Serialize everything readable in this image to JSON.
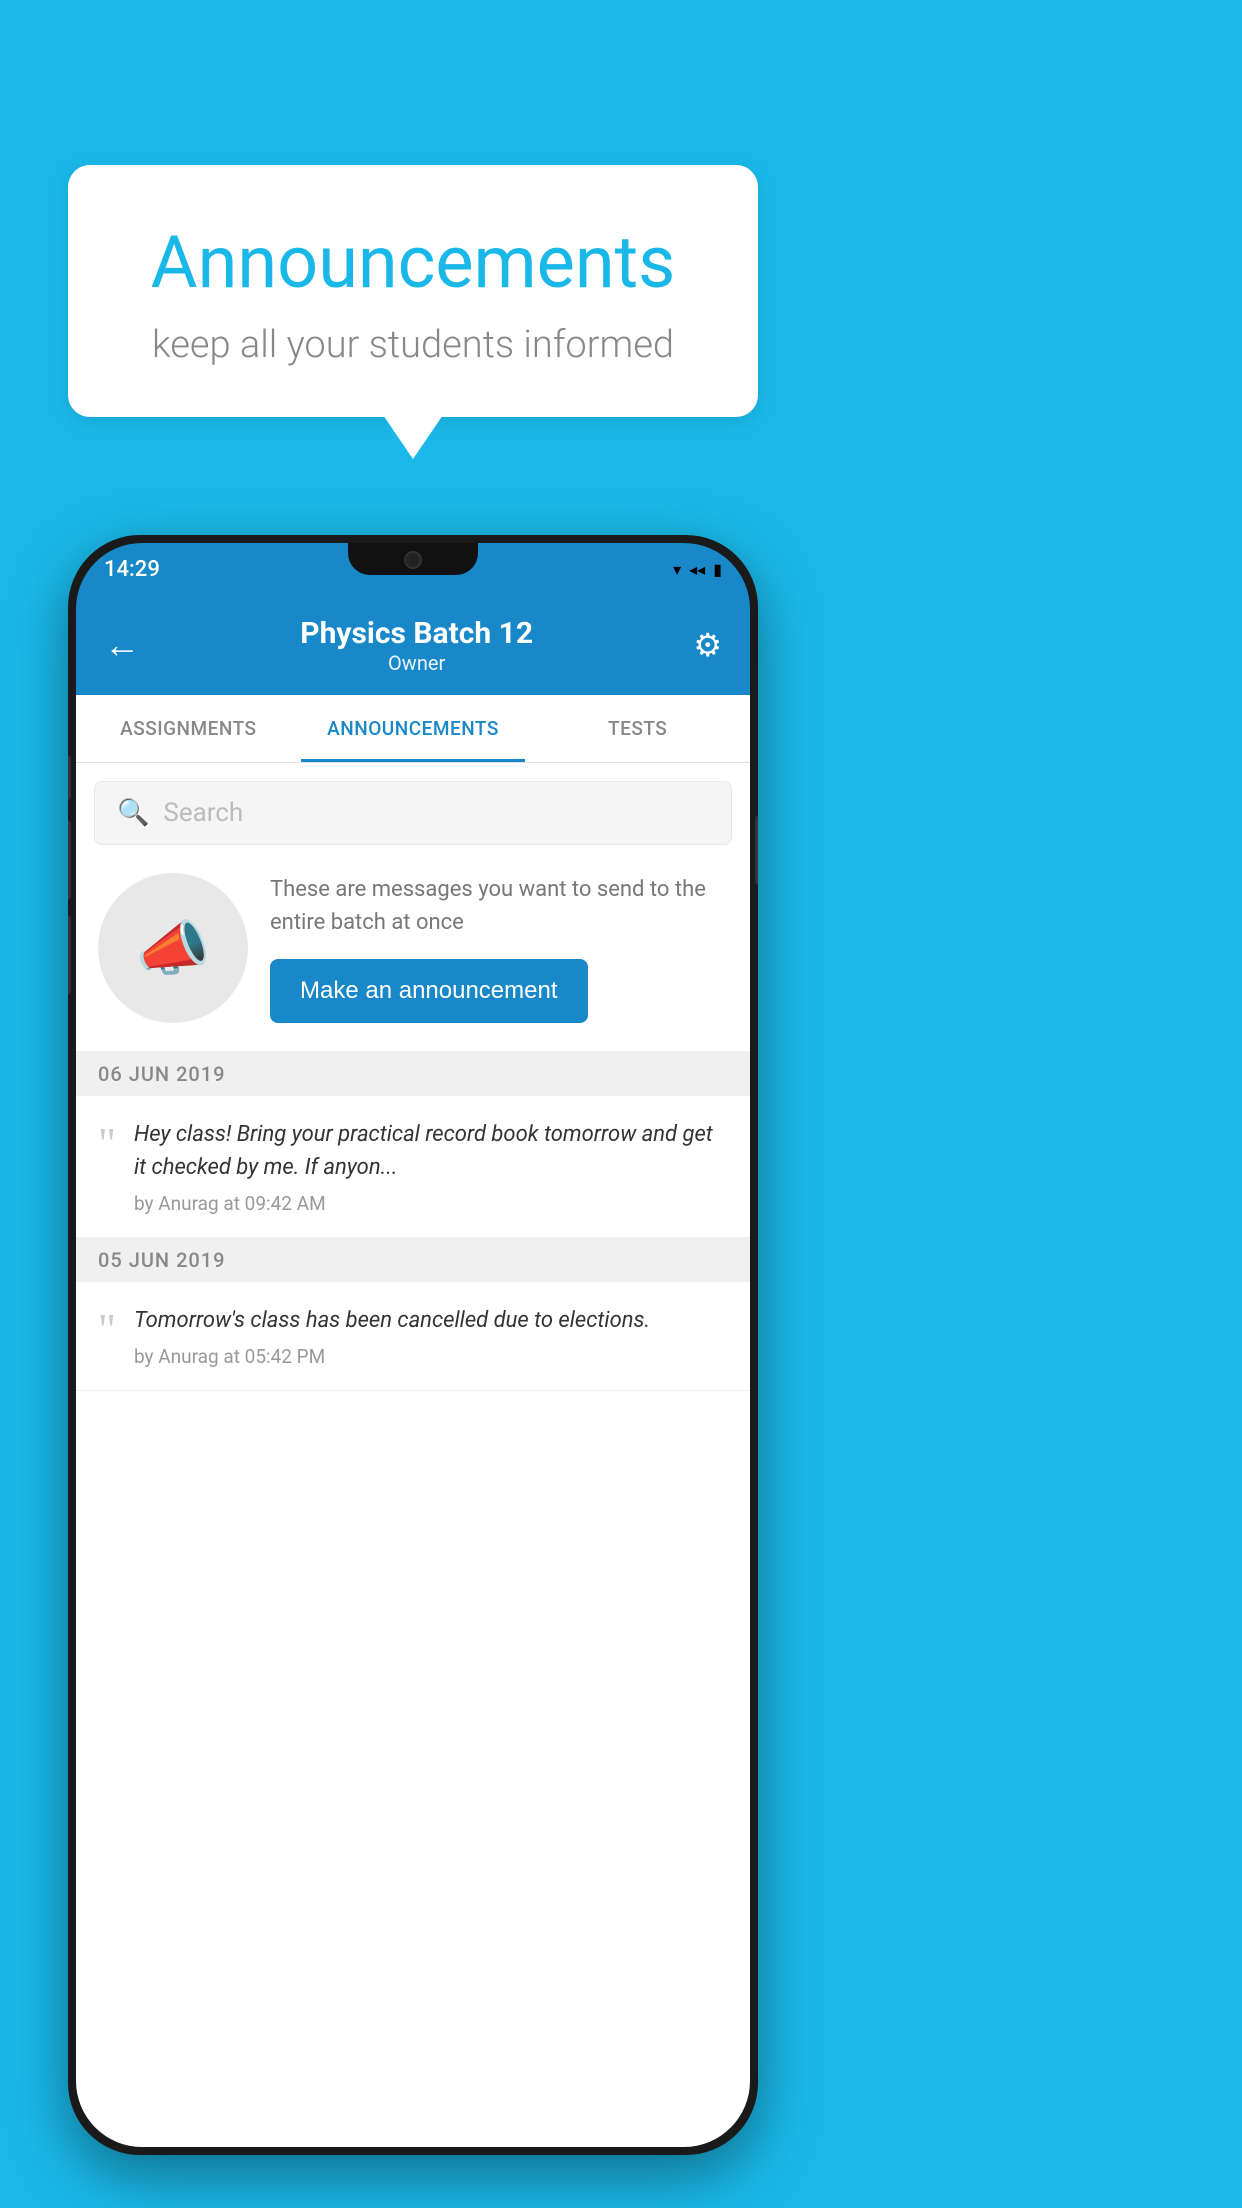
{
  "background_color": "#1ab8e8",
  "speech_bubble": {
    "title": "Announcements",
    "subtitle": "keep all your students informed"
  },
  "phone": {
    "status_bar": {
      "time": "14:29",
      "wifi": "▾",
      "signal": "▴",
      "battery": "▮"
    },
    "app_bar": {
      "back_label": "←",
      "title": "Physics Batch 12",
      "subtitle": "Owner",
      "settings_label": "⚙"
    },
    "tabs": [
      {
        "label": "ASSIGNMENTS",
        "active": false
      },
      {
        "label": "ANNOUNCEMENTS",
        "active": true
      },
      {
        "label": "TESTS",
        "active": false
      }
    ],
    "search": {
      "placeholder": "Search"
    },
    "announcement_promo": {
      "description": "These are messages you want to send to the entire batch at once",
      "button_label": "Make an announcement"
    },
    "date_groups": [
      {
        "date": "06  JUN  2019",
        "items": [
          {
            "text": "Hey class! Bring your practical record book tomorrow and get it checked by me. If anyon...",
            "meta": "by Anurag at 09:42 AM"
          }
        ]
      },
      {
        "date": "05  JUN  2019",
        "items": [
          {
            "text": "Tomorrow's class has been cancelled due to elections.",
            "meta": "by Anurag at 05:42 PM"
          }
        ]
      }
    ]
  }
}
